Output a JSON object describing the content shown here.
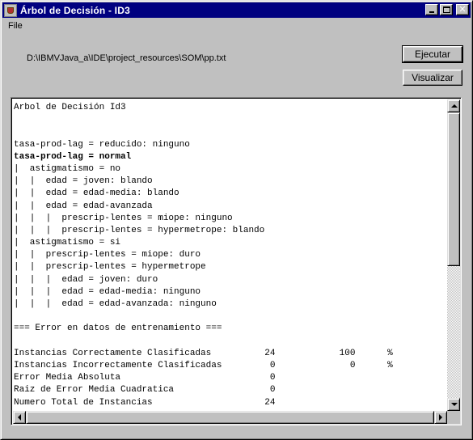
{
  "window": {
    "title": "Árbol de Decisión - ID3",
    "icon": "java-cup-icon",
    "title_bar_color": "#000080"
  },
  "menubar": {
    "items": [
      "File"
    ]
  },
  "file_path": "D:\\IBMVJava_a\\IDE\\project_resources\\SOM\\pp.txt",
  "buttons": {
    "run_label": "Ejecutar",
    "visualize_label": "Visualizar"
  },
  "output": {
    "lines": [
      {
        "text": "Arbol de Decisión Id3",
        "bold": false
      },
      {
        "text": "",
        "bold": false
      },
      {
        "text": "",
        "bold": false
      },
      {
        "text": "tasa-prod-lag = reducido: ninguno",
        "bold": false
      },
      {
        "text": "tasa-prod-lag = normal",
        "bold": true
      },
      {
        "text": "|  astigmatismo = no",
        "bold": false
      },
      {
        "text": "|  |  edad = joven: blando",
        "bold": false
      },
      {
        "text": "|  |  edad = edad-media: blando",
        "bold": false
      },
      {
        "text": "|  |  edad = edad-avanzada",
        "bold": false
      },
      {
        "text": "|  |  |  prescrip-lentes = miope: ninguno",
        "bold": false
      },
      {
        "text": "|  |  |  prescrip-lentes = hypermetrope: blando",
        "bold": false
      },
      {
        "text": "|  astigmatismo = si",
        "bold": false
      },
      {
        "text": "|  |  prescrip-lentes = miope: duro",
        "bold": false
      },
      {
        "text": "|  |  prescrip-lentes = hypermetrope",
        "bold": false
      },
      {
        "text": "|  |  |  edad = joven: duro",
        "bold": false
      },
      {
        "text": "|  |  |  edad = edad-media: ninguno",
        "bold": false
      },
      {
        "text": "|  |  |  edad = edad-avanzada: ninguno",
        "bold": false
      },
      {
        "text": "",
        "bold": false
      },
      {
        "text": "=== Error en datos de entrenamiento ===",
        "bold": false
      },
      {
        "text": "",
        "bold": false
      },
      {
        "text": "Instancias Correctamente Clasificadas          24            100      %",
        "bold": false
      },
      {
        "text": "Instancias Incorrectamente Clasificadas         0              0      %",
        "bold": false
      },
      {
        "text": "Error Media Absoluta                            0",
        "bold": false
      },
      {
        "text": "Raiz de Error Media Cuadratica                  0",
        "bold": false
      },
      {
        "text": "Numero Total de Instancias                     24",
        "bold": false
      }
    ]
  }
}
